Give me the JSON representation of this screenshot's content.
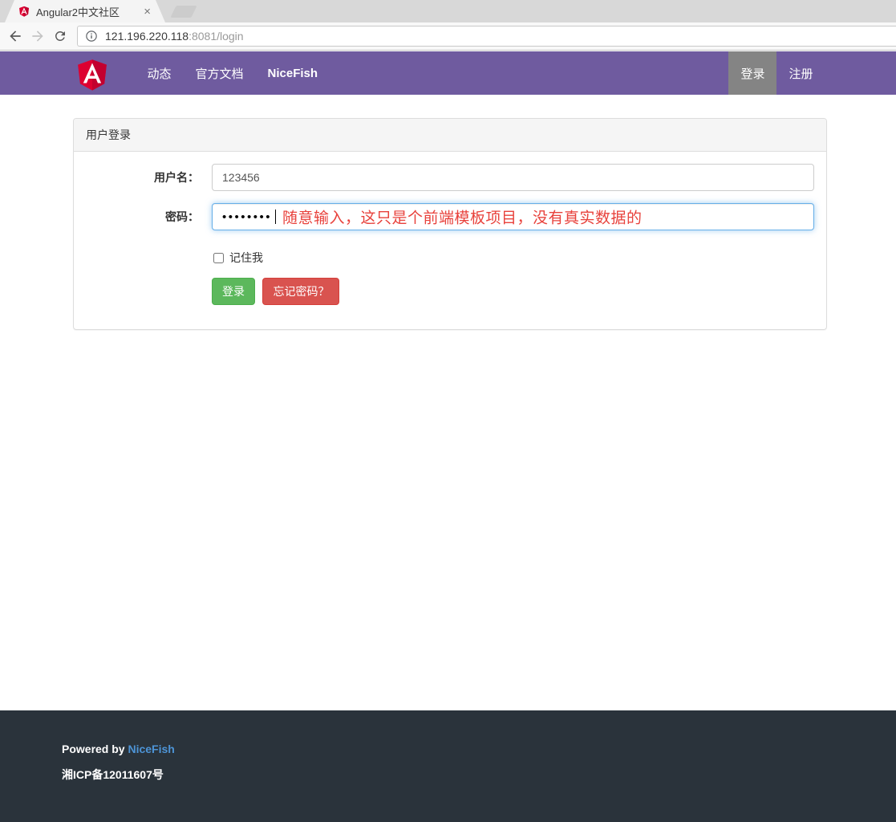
{
  "browser": {
    "tab_title": "Angular2中文社区",
    "close_glyph": "×",
    "url_host": "121.196.220.118",
    "url_path": ":8081/login"
  },
  "navbar": {
    "items": [
      {
        "label": "动态"
      },
      {
        "label": "官方文档"
      },
      {
        "label": "NiceFish"
      }
    ],
    "right_items": [
      {
        "label": "登录"
      },
      {
        "label": "注册"
      }
    ]
  },
  "login": {
    "panel_title": "用户登录",
    "username_label": "用户名：",
    "username_value": "123456",
    "password_label": "密码：",
    "password_value": "••••••••",
    "password_hint": "随意输入，这只是个前端模板项目，没有真实数据的",
    "remember_label": "记住我",
    "login_button": "登录",
    "forgot_button": "忘记密码？"
  },
  "footer": {
    "powered_by": "Powered by",
    "powered_link": "NiceFish",
    "icp": "湘ICP备12011607号"
  },
  "colors": {
    "navbar_bg": "#6f5b9f",
    "navbar_active_bg": "#848484",
    "success_green": "#5cb85c",
    "danger_red": "#d9534f",
    "footer_bg": "#2a333b",
    "footer_link_blue": "#4d94d6",
    "hint_red": "#e8423c",
    "angular_red": "#dd0031",
    "angular_dark_red": "#c3002f",
    "focus_blue": "#66afe9"
  }
}
